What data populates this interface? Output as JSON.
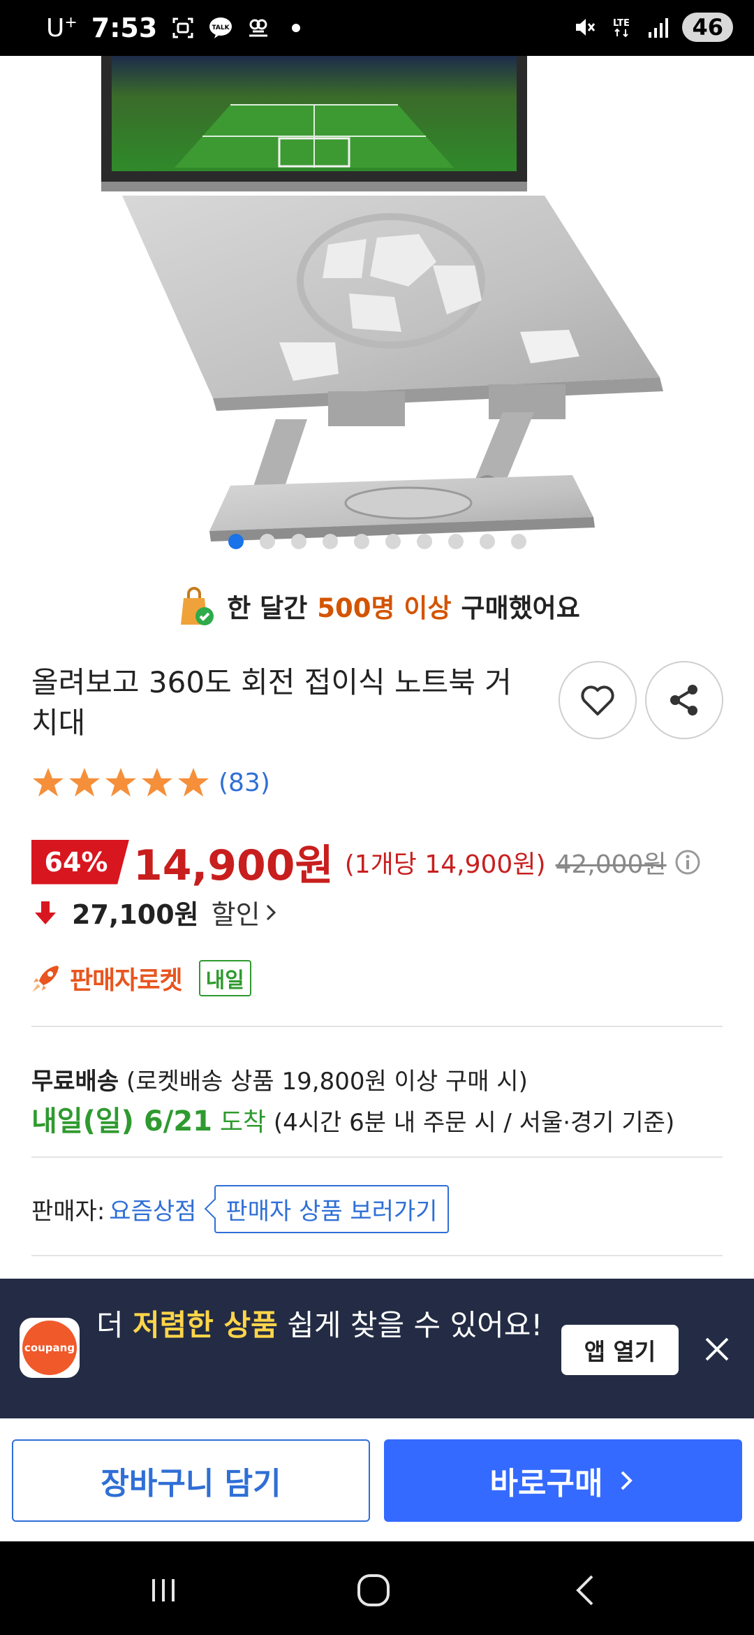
{
  "status_bar": {
    "carrier": "U",
    "carrier_sup": "+",
    "time": "7:53",
    "network": "LTE",
    "battery": "46",
    "icons": [
      "screenshot-icon",
      "kakaotalk-icon",
      "notification-icon",
      "dot-icon",
      "mute-icon",
      "lte-icon",
      "signal-icon"
    ]
  },
  "gallery": {
    "image_icon": "laptop-stand-image",
    "total_dots": 10,
    "active_index": 0
  },
  "purchase_banner": {
    "prefix": "한 달간",
    "highlight": "500명 이상",
    "suffix": "구매했어요"
  },
  "product": {
    "title": "올려보고 360도 회전 접이식 노트북 거치대",
    "rating_stars": 5,
    "review_count": "(83)",
    "discount_rate": "64%",
    "sale_price": "14,900원",
    "unit_price": "(1개당 14,900원)",
    "original_price": "42,000원",
    "discount_amount": "27,100원",
    "discount_label": "할인",
    "rocket_label": "판매자로켓",
    "tomorrow_badge": "내일"
  },
  "shipping": {
    "free_label": "무료배송",
    "free_condition": "(로켓배송 상품 19,800원 이상 구매 시)",
    "arrival_date": "내일(일) 6/21",
    "arrival_word": "도착",
    "arrival_condition": "(4시간 6분 내 주문 시 / 서울·경기 기준)"
  },
  "seller": {
    "label": "판매자:",
    "name": "요즘상점",
    "link_label": "판매자 상품 보러가기"
  },
  "app_banner": {
    "logo_text": "coupang",
    "text_prefix": "더",
    "text_highlight": "저렴한 상품",
    "text_suffix": "쉽게 찾을 수 있어요!",
    "open_label": "앱 열기"
  },
  "bottom_bar": {
    "cart_label": "장바구니 담기",
    "buy_label": "바로구매"
  },
  "colors": {
    "accent_blue": "#346aff",
    "price_red": "#c81e1e",
    "rocket_orange": "#e8551f",
    "delivery_green": "#2f9a2f",
    "banner_bg": "#232c44",
    "star": "#f58f3a"
  }
}
